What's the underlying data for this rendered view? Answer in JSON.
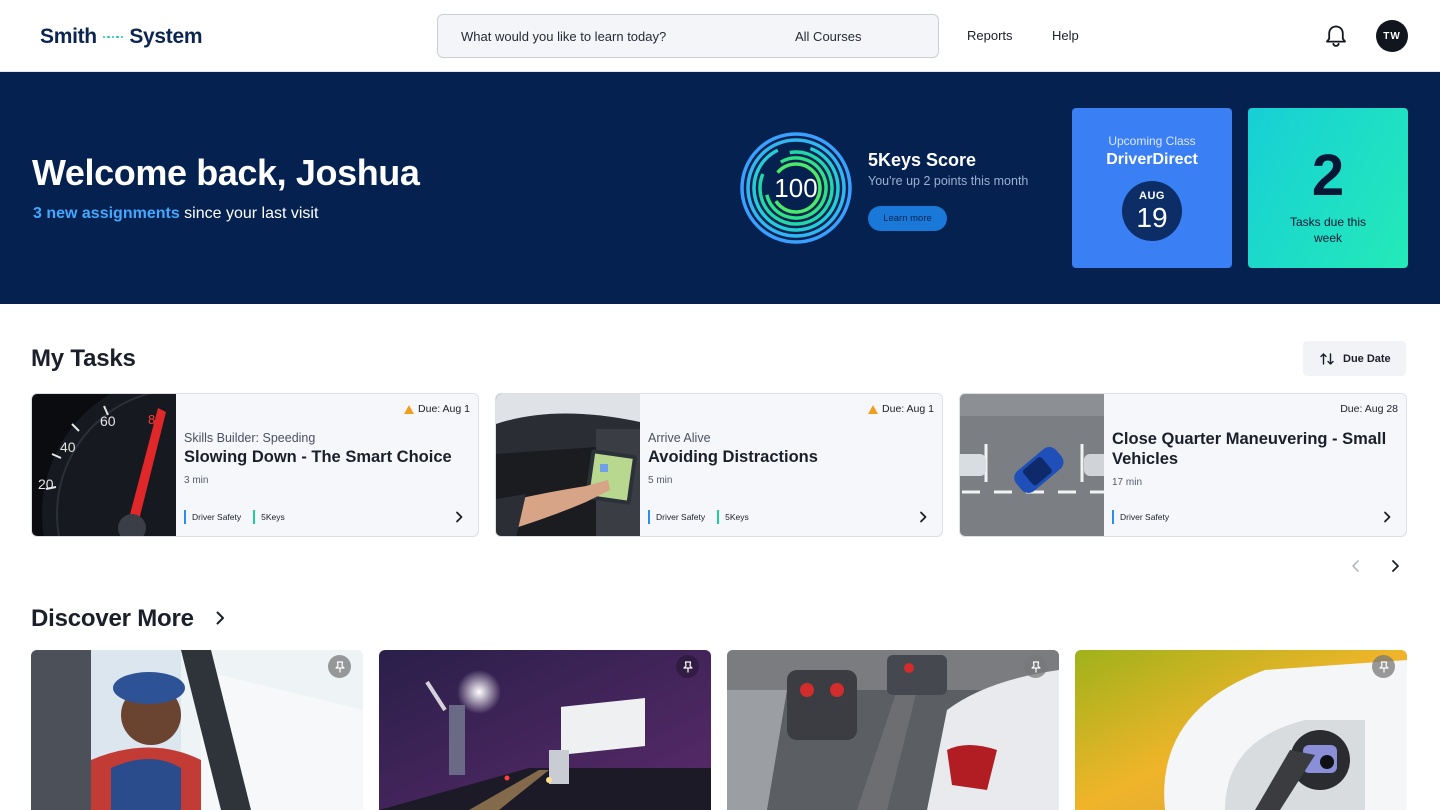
{
  "header": {
    "logo_left": "Smith",
    "logo_right": "System",
    "search_placeholder": "What would you like to learn today?",
    "search_scope": "All Courses",
    "nav": [
      "Reports",
      "Help"
    ],
    "avatar_initials": "TW"
  },
  "hero": {
    "greeting": "Welcome back, Joshua",
    "assignments_highlight": "3 new assignments",
    "assignments_rest": " since your last visit",
    "score": "100",
    "score_title": "5Keys Score",
    "score_sub": "You're up 2 points this month",
    "learn_more": "Learn more",
    "upcoming_label": "Upcoming Class",
    "upcoming_name": "DriverDirect",
    "upcoming_month": "AUG",
    "upcoming_day": "19",
    "tasks_due_count": "2",
    "tasks_due_label": "Tasks due this week"
  },
  "tasks": {
    "title": "My Tasks",
    "sort_label": "Due Date",
    "items": [
      {
        "due": "Due: Aug 1",
        "warning": true,
        "category": "Skills Builder: Speeding",
        "title": "Slowing Down - The Smart Choice",
        "duration": "3 min",
        "tags": [
          "Driver Safety",
          "5Keys"
        ]
      },
      {
        "due": "Due: Aug 1",
        "warning": true,
        "category": "Arrive Alive",
        "title": "Avoiding Distractions",
        "duration": "5 min",
        "tags": [
          "Driver Safety",
          "5Keys"
        ]
      },
      {
        "due": "Due: Aug 28",
        "warning": false,
        "category": "",
        "title": "Close Quarter Maneuvering - Small Vehicles",
        "duration": "17 min",
        "tags": [
          "Driver Safety"
        ]
      }
    ]
  },
  "discover": {
    "title": "Discover More"
  },
  "colors": {
    "navy": "#04214f",
    "accent_blue": "#43a8ff",
    "card_blue": "#3a7ff4",
    "teal": "#24eab8"
  },
  "icons": [
    "bell-icon",
    "sort-icon",
    "warning-icon",
    "chevron-right-icon",
    "chevron-left-icon",
    "pin-icon"
  ]
}
